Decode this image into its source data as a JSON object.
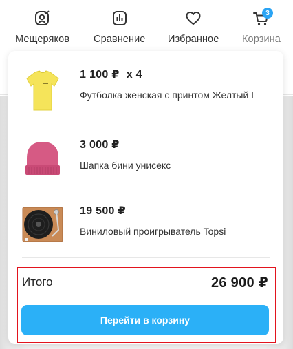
{
  "nav": {
    "items": [
      {
        "label": "Мещеряков",
        "icon": "profile-icon"
      },
      {
        "label": "Сравнение",
        "icon": "compare-chart-icon"
      },
      {
        "label": "Избранное",
        "icon": "heart-icon"
      },
      {
        "label": "Корзина",
        "icon": "cart-icon",
        "badge": "3"
      }
    ]
  },
  "cart": {
    "items": [
      {
        "price": "1 100 ₽",
        "quantity": "x 4",
        "name": "Футболка женская с принтом Желтый L",
        "image": "yellow-tshirt"
      },
      {
        "price": "3 000 ₽",
        "quantity": "",
        "name": "Шапка бини унисекс",
        "image": "pink-beanie"
      },
      {
        "price": "19 500 ₽",
        "quantity": "",
        "name": "Виниловый проигрыватель Topsi",
        "image": "turntable"
      }
    ],
    "total_label": "Итого",
    "total_value": "26 900 ₽",
    "checkout_label": "Перейти в корзину"
  },
  "colors": {
    "accent": "#2bb0f7",
    "badge": "#2aa4f4",
    "highlight": "#e2141e"
  }
}
